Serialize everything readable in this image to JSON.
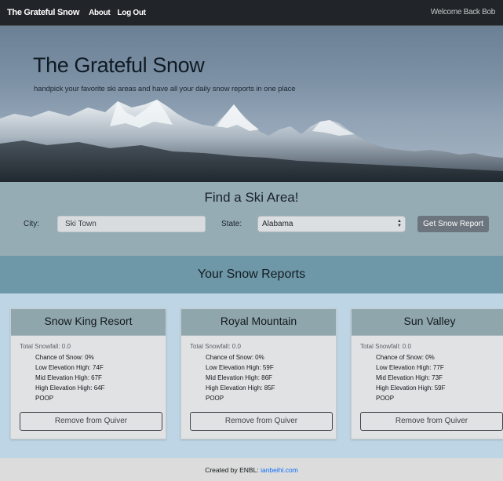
{
  "navbar": {
    "brand": "The Grateful Snow",
    "links": [
      "About",
      "Log Out"
    ],
    "welcome": "Welcome Back Bob"
  },
  "hero": {
    "title": "The Grateful Snow",
    "subtitle": "handpick your favorite ski areas and have all your daily snow reports in one place"
  },
  "search": {
    "title": "Find a Ski Area!",
    "city_label": "City:",
    "city_placeholder": "Ski Town",
    "state_label": "State:",
    "state_value": "Alabama",
    "button": "Get Snow Report"
  },
  "reports": {
    "title": "Your Snow Reports",
    "cards": [
      {
        "name": "Snow King Resort",
        "total": "Total Snowfall: 0.0",
        "chance": "Chance of Snow: 0%",
        "low": "Low Elevation High: 74F",
        "mid": "Mid Elevation High: 67F",
        "high": "High Elevation High: 64F",
        "extra": "POOP",
        "button": "Remove from Quiver"
      },
      {
        "name": "Royal Mountain",
        "total": "Total Snowfall: 0.0",
        "chance": "Chance of Snow: 0%",
        "low": "Low Elevation High: 59F",
        "mid": "Mid Elevation High: 86F",
        "high": "High Elevation High: 85F",
        "extra": "POOP",
        "button": "Remove from Quiver"
      },
      {
        "name": "Sun Valley",
        "total": "Total Snowfall: 0.0",
        "chance": "Chance of Snow: 0%",
        "low": "Low Elevation High: 77F",
        "mid": "Mid Elevation High: 73F",
        "high": "High Elevation High: 59F",
        "extra": "POOP",
        "button": "Remove from Quiver"
      }
    ]
  },
  "footer": {
    "text": "Created by ENBL:",
    "link": "ianbeihl.com"
  },
  "colors": {
    "navbar": "#212529",
    "search_band": "#95acb5",
    "reports_band": "#6e97a8",
    "card_header": "#8fa6ad",
    "page_bg": "#bdd5e4",
    "button_gray": "#6c757d",
    "link_blue": "#0d6efd"
  }
}
